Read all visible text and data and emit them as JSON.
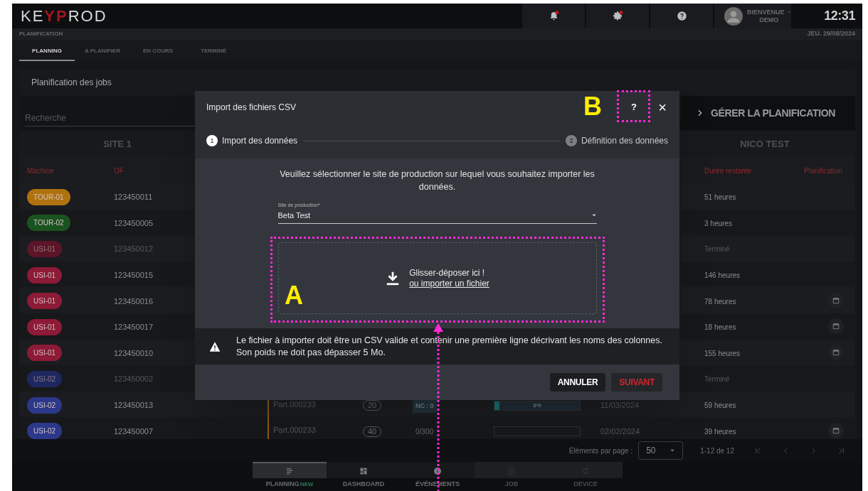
{
  "header": {
    "logo": [
      "KE",
      "YP",
      "ROD"
    ],
    "actions": [
      {
        "kind": "bell",
        "alert": true
      },
      {
        "kind": "gear",
        "alert": true
      },
      {
        "kind": "help",
        "alert": false
      }
    ],
    "user": {
      "greeting": "BIENVENUE",
      "name": "DEMO"
    },
    "time": "12:31"
  },
  "section": {
    "title": "PLANIFICATION",
    "date": "JEU. 29/08/2024"
  },
  "tabs": [
    {
      "label": "PLANNING",
      "selected": true
    },
    {
      "label": "A PLANIFIER",
      "selected": false
    },
    {
      "label": "EN COURS",
      "selected": false
    },
    {
      "label": "TERMINÉ",
      "selected": false
    }
  ],
  "card": {
    "title": "Planification des jobs",
    "search": {
      "placeholder": "Recherche"
    },
    "manage_button": "GÉRER LA PLANIFICATION",
    "groups": [
      "SITE 1",
      "NICO TEST"
    ],
    "columns": [
      "Machine",
      "OF",
      "Durée restante",
      "Planification"
    ],
    "rows": [
      {
        "machine": "TOUR-01",
        "color": "#b0720f",
        "of": "123450011",
        "remaining": "51 heures",
        "dimmed": false,
        "schedule": false
      },
      {
        "machine": "TOUR-02",
        "color": "#1b5320",
        "of": "123450005",
        "remaining": "3 heures",
        "dimmed": false,
        "schedule": false
      },
      {
        "machine": "USI-01",
        "color": "#5c1426",
        "of": "123450012",
        "remaining": "Terminé",
        "dimmed": true,
        "schedule": false
      },
      {
        "machine": "USI-01",
        "color": "#8d1a36",
        "of": "123450015",
        "remaining": "146 heures",
        "dimmed": false,
        "schedule": false
      },
      {
        "machine": "USI-01",
        "color": "#8d1a36",
        "of": "123450016",
        "remaining": "78 heures",
        "dimmed": false,
        "schedule": true
      },
      {
        "machine": "USI-01",
        "color": "#8d1a36",
        "of": "123450017",
        "remaining": "18 heures",
        "dimmed": false,
        "schedule": true
      },
      {
        "machine": "USI-01",
        "color": "#8d1a36",
        "of": "123450010",
        "remaining": "155 heures",
        "dimmed": false,
        "schedule": true
      },
      {
        "machine": "USI-02",
        "color": "#1f2760",
        "of": "123450002",
        "remaining": "Terminé",
        "dimmed": true,
        "schedule": false
      },
      {
        "machine": "USI-02",
        "color": "#2c388a",
        "of": "123450013",
        "part": "Part.000233",
        "quantity": "20",
        "count": "NC : 0",
        "progress": {
          "level": 0.06,
          "label": "6%"
        },
        "date": "11/03/2024",
        "remaining": "59 heures",
        "dimmed": false,
        "schedule": false
      },
      {
        "machine": "USI-02",
        "color": "#2c388a",
        "of": "123450007",
        "part": "Part.000233",
        "quantity": "40",
        "count": "0/300",
        "progress": {
          "level": 0
        },
        "date": "02/02/2024",
        "remaining": "39 heures",
        "dimmed": false,
        "schedule": true
      }
    ]
  },
  "pagination": {
    "label": "Éléments par page :",
    "page_size": "50",
    "range": "1-12 de 12"
  },
  "bottom_nav": [
    {
      "kind": "planning",
      "label": "PLANNING",
      "badge": "NEW",
      "selected": true,
      "disabled": false
    },
    {
      "kind": "dashboard",
      "label": "DASHBOARD",
      "selected": false,
      "disabled": false
    },
    {
      "kind": "events",
      "label": "ÉVÉNEMENTS",
      "selected": false,
      "disabled": false
    },
    {
      "kind": "job",
      "label": "JOB",
      "selected": false,
      "disabled": true
    },
    {
      "kind": "device",
      "label": "DEVICE",
      "selected": false,
      "disabled": true
    }
  ],
  "dialog": {
    "title": "Import des fichiers CSV",
    "help": "?",
    "close": "×",
    "steps": [
      {
        "number": "1",
        "label": "Import des données",
        "active": true
      },
      {
        "number": "2",
        "label": "Définition des données",
        "active": false
      }
    ],
    "instruction": "Veuillez sélectionner le site de production sur lequel vous souhaitez importer les données.",
    "site_field": {
      "label": "Site de production*",
      "value": "Beta Test"
    },
    "dropzone": {
      "text": "Glisser-déposer ici !",
      "link": "ou importer un fichier"
    },
    "warning": "Le fichier à importer doit être un CSV valide et contenir une première ligne décrivant les noms des colonnes. Son poids ne doit pas dépasser 5 Mo.",
    "buttons": [
      {
        "label": "ANNULER",
        "kind": "secondary"
      },
      {
        "label": "SUIVANT",
        "kind": "primary"
      }
    ]
  },
  "annotations": [
    {
      "label": "A",
      "arrow": true
    },
    {
      "label": "B",
      "arrow": false
    }
  ]
}
